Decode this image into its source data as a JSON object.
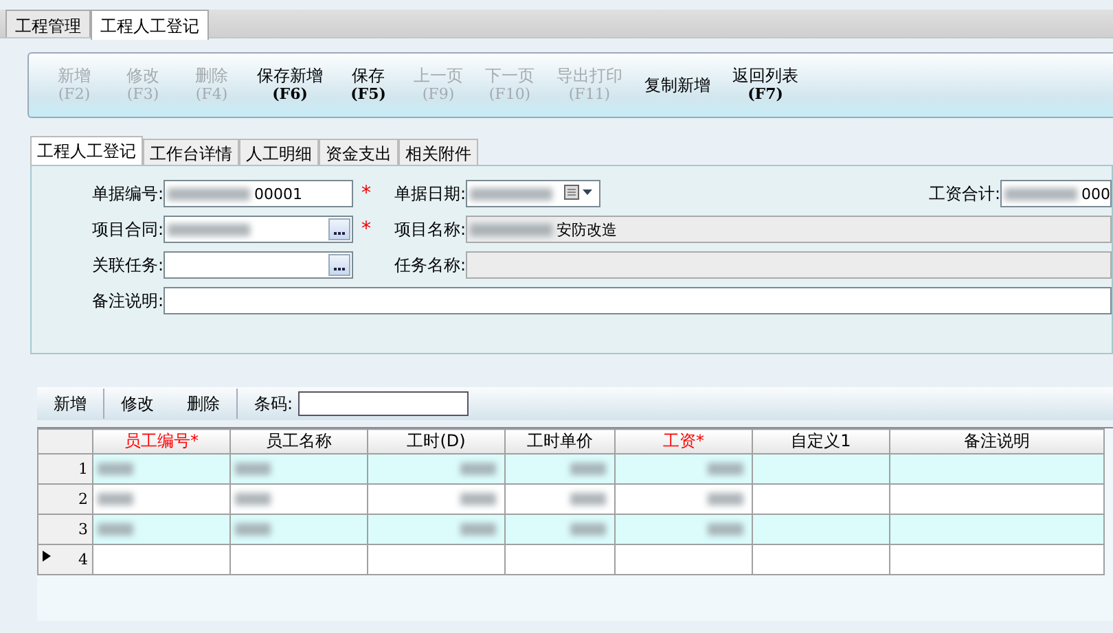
{
  "top_tabs": [
    {
      "label": "工程管理",
      "selected": false
    },
    {
      "label": "工程人工登记",
      "selected": true
    }
  ],
  "toolbar": [
    {
      "label": "新增",
      "key": "(F2)",
      "disabled": true
    },
    {
      "label": "修改",
      "key": "(F3)",
      "disabled": true
    },
    {
      "label": "删除",
      "key": "(F4)",
      "disabled": true
    },
    {
      "label": "保存新增",
      "key": "(F6)",
      "disabled": false
    },
    {
      "label": "保存",
      "key": "(F5)",
      "disabled": false
    },
    {
      "label": "上一页",
      "key": "(F9)",
      "disabled": true
    },
    {
      "label": "下一页",
      "key": "(F10)",
      "disabled": true
    },
    {
      "label": "导出打印",
      "key": "(F11)",
      "disabled": true
    },
    {
      "label": "复制新增",
      "disabled": false
    },
    {
      "label": "返回列表",
      "key": "(F7)",
      "disabled": false
    }
  ],
  "sub_tabs": [
    {
      "label": "工程人工登记",
      "selected": true
    },
    {
      "label": "工作台详情",
      "selected": false
    },
    {
      "label": "人工明细",
      "selected": false
    },
    {
      "label": "资金支出",
      "selected": false
    },
    {
      "label": "相关附件",
      "selected": false
    }
  ],
  "form": {
    "fields": [
      {
        "label": "单据编号:",
        "kind": "text",
        "value": "00001",
        "blurred": true,
        "required_mark": "*"
      },
      {
        "label": "单据日期:",
        "kind": "date",
        "blurred": true
      },
      {
        "label": "工资合计:",
        "kind": "text",
        "value": "000",
        "blurred": true
      },
      {
        "label": "项目合同:",
        "kind": "lookup",
        "blurred": true,
        "required_mark": "*"
      },
      {
        "label": "项目名称:",
        "kind": "readonly",
        "value": "安防改造",
        "blurred": true
      },
      {
        "label": "关联任务:",
        "kind": "lookup",
        "blurred": false
      },
      {
        "label": "任务名称:",
        "kind": "readonly",
        "blurred": false
      },
      {
        "label": "备注说明:",
        "kind": "wide",
        "blurred": false
      }
    ]
  },
  "grid_toolbar": {
    "buttons": [
      "新增",
      "修改",
      "删除"
    ],
    "barcode_label": "条码:"
  },
  "grid": {
    "columns": [
      {
        "label": "员工编号*",
        "required": true
      },
      {
        "label": "员工名称",
        "required": false
      },
      {
        "label": "工时(D)",
        "required": false
      },
      {
        "label": "工时单价",
        "required": false
      },
      {
        "label": "工资*",
        "required": true
      },
      {
        "label": "自定义1",
        "required": false
      },
      {
        "label": "备注说明",
        "required": false
      }
    ],
    "rows": [
      {
        "number": "1",
        "current": false,
        "blurred": [
          true,
          true,
          true,
          true,
          true,
          false,
          false
        ]
      },
      {
        "number": "2",
        "current": false,
        "blurred": [
          true,
          true,
          true,
          true,
          true,
          false,
          false
        ]
      },
      {
        "number": "3",
        "current": false,
        "blurred": [
          true,
          true,
          true,
          true,
          true,
          false,
          false
        ]
      },
      {
        "number": "4",
        "current": true,
        "blurred": [
          false,
          false,
          false,
          false,
          false,
          false,
          false
        ]
      }
    ]
  }
}
